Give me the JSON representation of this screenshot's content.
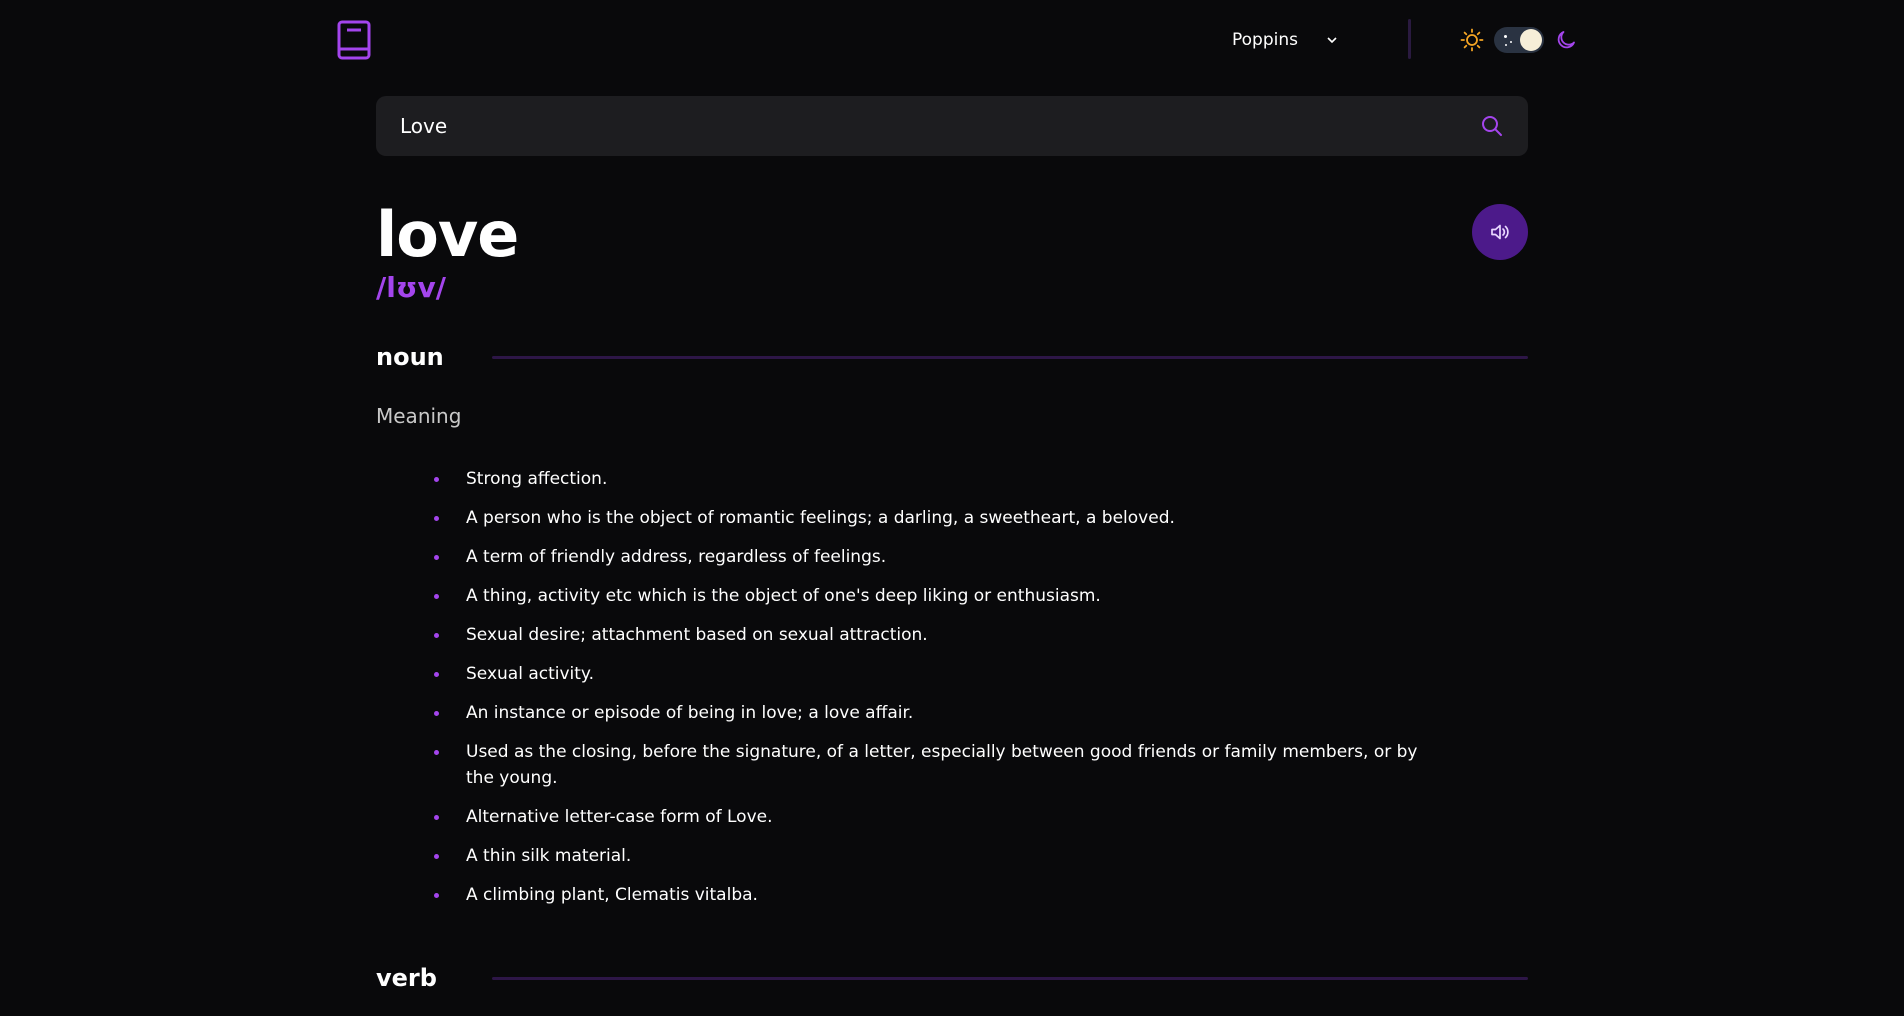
{
  "header": {
    "font_selector": {
      "value": "Poppins"
    },
    "theme_toggle": {
      "mode": "dark"
    }
  },
  "search": {
    "value": "Love"
  },
  "entry": {
    "word": "love",
    "phonetic": "/lʊv/",
    "sections": [
      {
        "part_of_speech": "noun",
        "meaning_label": "Meaning",
        "definitions": [
          "Strong affection.",
          "A person who is the object of romantic feelings; a darling, a sweetheart, a beloved.",
          "A term of friendly address, regardless of feelings.",
          "A thing, activity etc which is the object of one's deep liking or enthusiasm.",
          "Sexual desire; attachment based on sexual attraction.",
          "Sexual activity.",
          "An instance or episode of being in love; a love affair.",
          "Used as the closing, before the signature, of a letter, especially between good friends or family members, or by the young.",
          "Alternative letter-case form of Love.",
          "A thin silk material.",
          "A climbing plant, Clematis vitalba."
        ]
      },
      {
        "part_of_speech": "verb"
      }
    ]
  },
  "colors": {
    "accent": "#a445ed",
    "background": "#09090b",
    "search_background": "#1d1d20",
    "play_button": "#4c1a8a",
    "sun": "#f5a524",
    "section_line": "#2d1647"
  },
  "icons": [
    "book-icon",
    "chevron-down-icon",
    "sun-icon",
    "moon-icon",
    "search-icon",
    "speaker-icon"
  ]
}
